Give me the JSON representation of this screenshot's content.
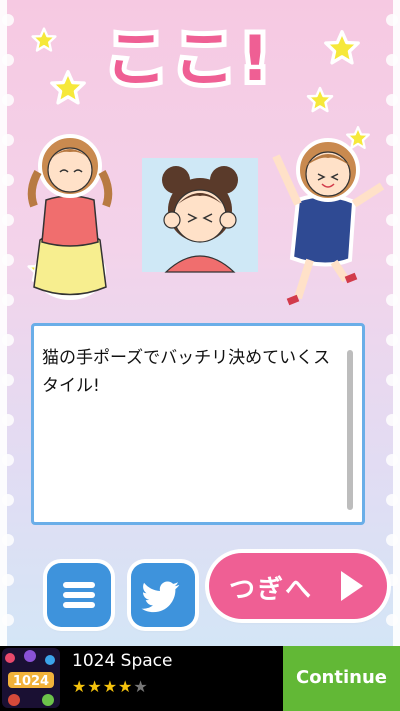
{
  "title": "ここ!",
  "message": "猫の手ポーズでバッチリ決めていくスタイル!",
  "buttons": {
    "next_label": "つぎへ",
    "menu_icon": "hamburger-menu-icon",
    "twitter_icon": "twitter-bird-icon",
    "next_icon": "play-arrow-icon"
  },
  "ad": {
    "game_icon_text": "1024",
    "title": "1024 Space",
    "rating": 4,
    "rating_max": 5,
    "cta": "Continue"
  },
  "colors": {
    "title_pink": "#ef5f94",
    "button_blue": "#3e93dc",
    "next_pink": "#ef5f94",
    "ad_green": "#62b836",
    "textbox_border": "#6aaee8",
    "star_yellow": "#f6e83a"
  }
}
